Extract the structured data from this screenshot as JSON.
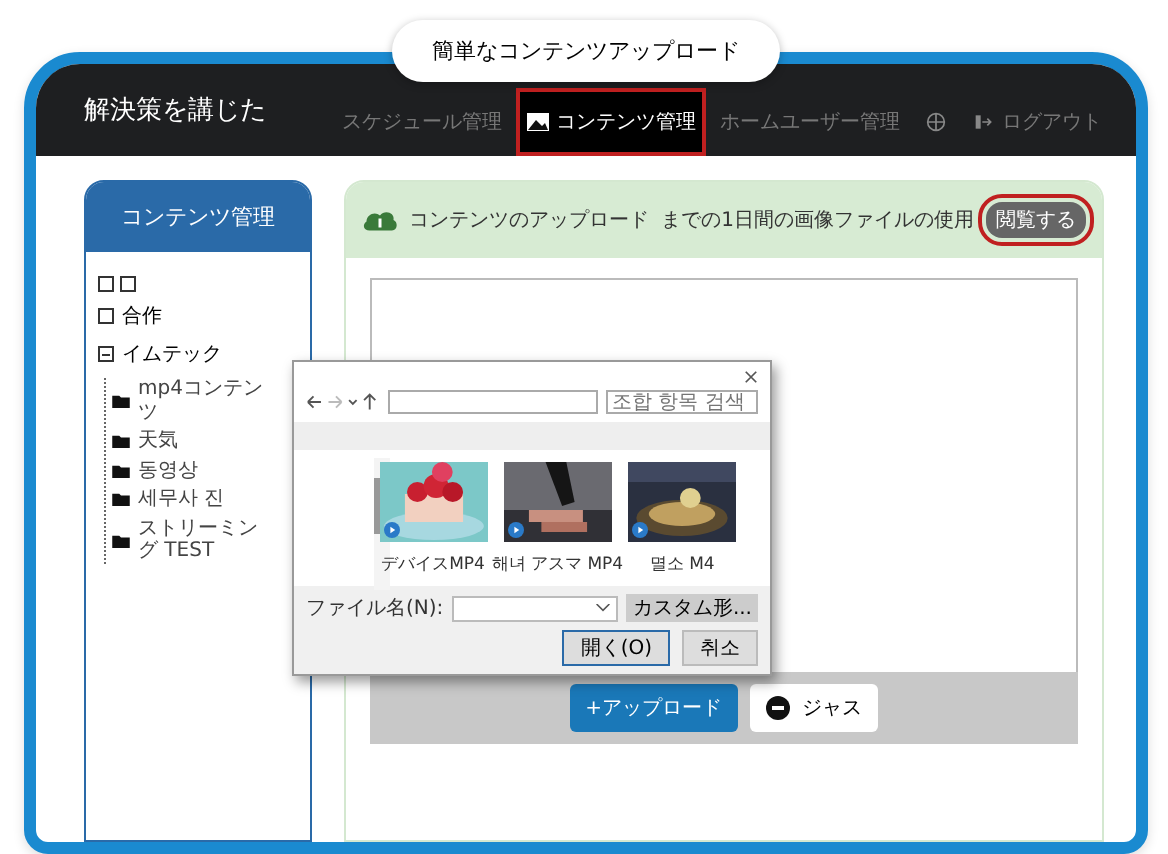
{
  "banner": {
    "title": "簡単なコンテンツアップロード"
  },
  "header": {
    "title": "解決策を講じた",
    "nav": [
      {
        "label": "スケジュール管理",
        "selected": false
      },
      {
        "label": "コンテンツ管理",
        "selected": true
      },
      {
        "label": "ホームユーザー管理",
        "selected": false
      },
      {
        "selected": false
      },
      {
        "label": "ログアウト",
        "selected": false
      }
    ]
  },
  "sidebar": {
    "title": "コンテンツ管理",
    "tree": [
      {
        "label": "合作",
        "expanded": false
      },
      {
        "label": "イムテック",
        "expanded": true,
        "children": [
          {
            "label": "mp4コンテンツ"
          },
          {
            "label": "天気"
          },
          {
            "label": "동영상"
          },
          {
            "label": "세무사 진"
          },
          {
            "label": "ストリーミング TEST"
          }
        ]
      }
    ]
  },
  "upload": {
    "title": "コンテンツのアップロード",
    "usage": "までの1日間の画像ファイルの使用",
    "browse_button": "閲覧する",
    "upload_button": "+アップロード",
    "cancel_button": "ジャス"
  },
  "dialog": {
    "search_placeholder": "조합 항목 검색",
    "files": [
      {
        "name": "デバイスMP4",
        "kind": "cake"
      },
      {
        "name": "해녀 アスマ MP4",
        "kind": "grill"
      },
      {
        "name": "멸소 M4",
        "kind": "pan"
      }
    ],
    "filename_label": "ファイル名(N):",
    "filter": "カスタム形...",
    "open_button": "開く(O)",
    "cancel_button": "취소"
  }
}
